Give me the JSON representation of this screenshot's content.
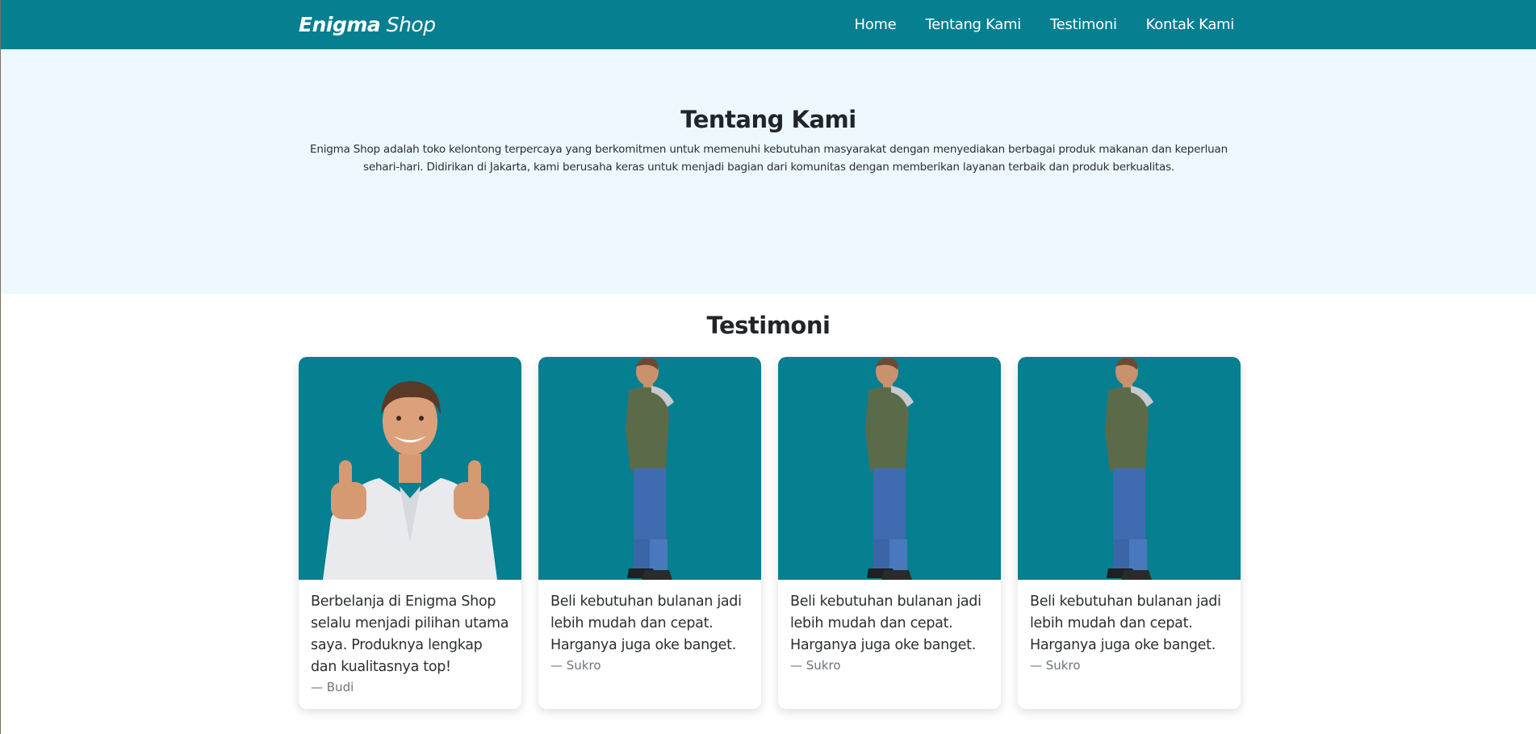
{
  "navbar": {
    "brand_bold": "Enigma",
    "brand_light": "Shop",
    "links": [
      "Home",
      "Tentang Kami",
      "Testimoni",
      "Kontak Kami"
    ]
  },
  "about": {
    "title": "Tentang Kami",
    "text": "Enigma Shop adalah toko kelontong terpercaya yang berkomitmen untuk memenuhi kebutuhan masyarakat dengan menyediakan berbagai produk makanan dan keperluan sehari-hari. Didirikan di Jakarta, kami berusaha keras untuk menjadi bagian dari komunitas dengan memberikan layanan terbaik dan produk berkualitas."
  },
  "testimonials": {
    "title": "Testimoni",
    "items": [
      {
        "quote": "Berbelanja di Enigma Shop selalu menjadi pilihan utama saya. Produknya lengkap dan kualitasnya top!",
        "author": "— Budi",
        "image": "man-thumbs-up-photo"
      },
      {
        "quote": "Beli kebutuhan bulanan jadi lebih mudah dan cepat. Harganya juga oke banget.",
        "author": "— Sukro",
        "image": "man-standing-side-photo"
      },
      {
        "quote": "Beli kebutuhan bulanan jadi lebih mudah dan cepat. Harganya juga oke banget.",
        "author": "— Sukro",
        "image": "man-standing-side-photo"
      },
      {
        "quote": "Beli kebutuhan bulanan jadi lebih mudah dan cepat. Harganya juga oke banget.",
        "author": "— Sukro",
        "image": "man-standing-side-photo"
      }
    ]
  },
  "colors": {
    "primary": "#067f91",
    "hero_bg": "#edf8fe",
    "text": "#212529",
    "muted": "#6c757d"
  }
}
